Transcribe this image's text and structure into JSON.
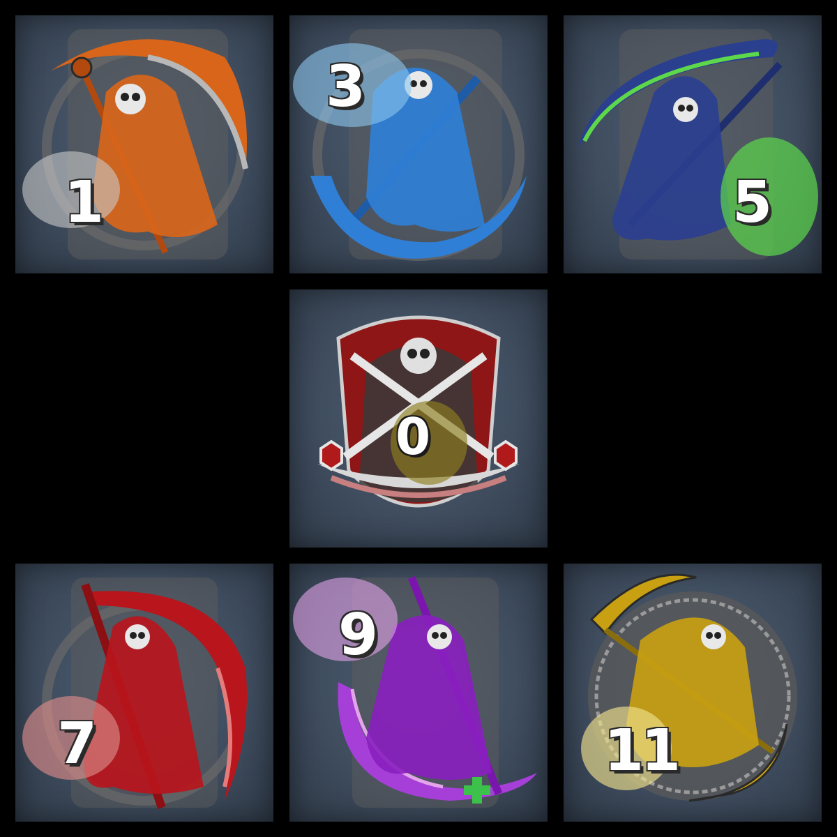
{
  "emblems": [
    {
      "number": "1",
      "color": "#d8651a",
      "splatter": "#c9c9c9"
    },
    {
      "number": "3",
      "color": "#2f7fd6",
      "splatter": "#8ec6ef"
    },
    {
      "number": "5",
      "color": "#2b3f8f",
      "splatter": "#5dd84a"
    },
    {
      "number": "0",
      "color": "#8e1616",
      "splatter": "#8e8020"
    },
    {
      "number": "7",
      "color": "#b8151c",
      "splatter": "#d88a88"
    },
    {
      "number": "9",
      "color": "#8a1fc0",
      "splatter": "#e3a4ea"
    },
    {
      "number": "11",
      "color": "#c8a012",
      "splatter": "#efe08e"
    }
  ],
  "icons": {
    "reaper": "grim-reaper-icon",
    "scythe": "scythe-icon",
    "shield": "shield-crest-icon"
  }
}
